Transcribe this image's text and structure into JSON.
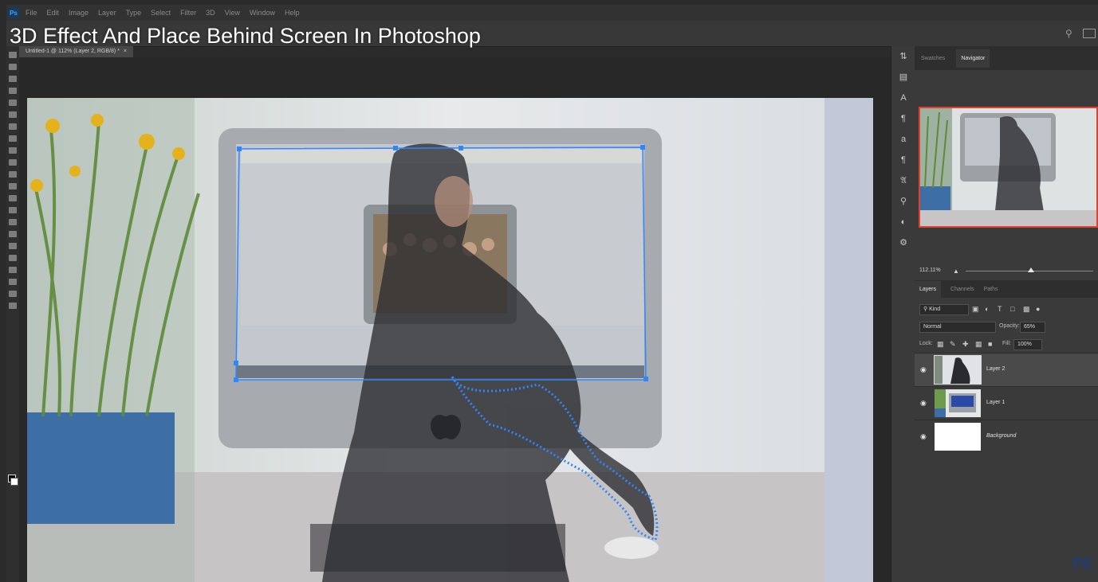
{
  "video_title": "3D Effect And Place Behind Screen In Photoshop",
  "app": {
    "logo": "Ps",
    "menu": [
      "File",
      "Edit",
      "Image",
      "Layer",
      "Type",
      "Select",
      "Filter",
      "3D",
      "View",
      "Window",
      "Help"
    ]
  },
  "document": {
    "tab_title": "Untitled-1 @ 112% (Layer 2, RGB/8) *",
    "close_glyph": "×"
  },
  "icons": {
    "search": "search-icon",
    "workspace": "workspace-icon",
    "visibility": "eye-icon"
  },
  "panels": {
    "top_tabs": [
      "Swatches",
      "Navigator"
    ],
    "zoom": "112.11%",
    "layer_tabs": [
      "Layers",
      "Channels",
      "Paths"
    ],
    "filter_kind": "Kind",
    "blend_mode": "Normal",
    "opacity_label": "Opacity:",
    "opacity_value": "65%",
    "lock_label": "Lock:",
    "fill_label": "Fill:",
    "fill_value": "100%",
    "layers": [
      {
        "name": "Layer 2",
        "selected": true
      },
      {
        "name": "Layer 1",
        "selected": false
      },
      {
        "name": "Background",
        "selected": false
      }
    ]
  },
  "watermark": {
    "brand": "PE"
  },
  "colors": {
    "accent": "#2f86ff",
    "navigator_border": "#e2412f"
  }
}
